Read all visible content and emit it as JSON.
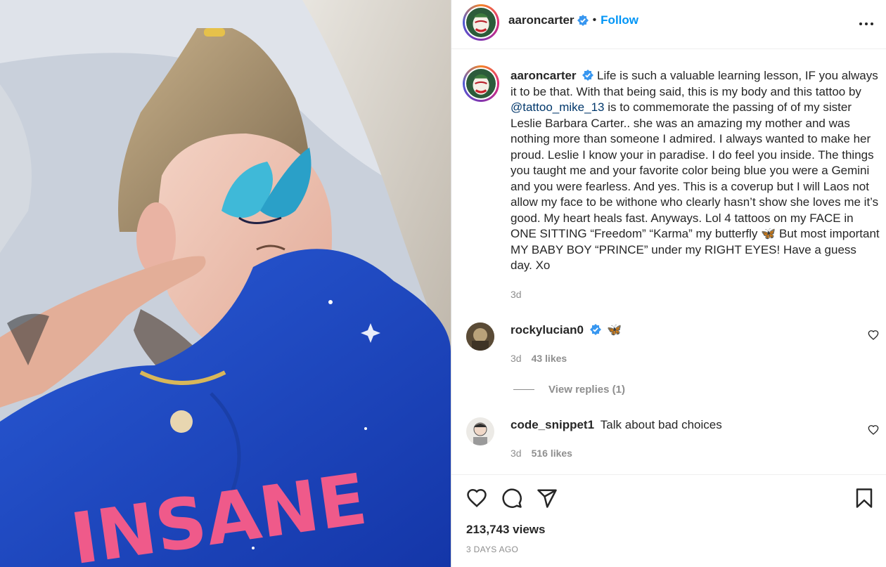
{
  "post": {
    "author": "aaroncarter",
    "follow_label": "Follow",
    "dot": "•",
    "image_label": "Post photo: man with butterfly face tattoo in blue hoodie",
    "caption_prefix": "Life is such a valuable learning lesson, IF you always it to be that. With that being said, this is my body and this tattoo by",
    "caption_mention": "@tattoo_mike_13",
    "caption_suffix": "is to commemorate the passing of of my sister Leslie Barbara Carter.. she was an amazing my mother and was nothing more than someone I admired. I always wanted to make her proud. Leslie I know your in paradise. I do feel you inside. The things you taught me and your favorite color being blue you were a Gemini and you were fearless. And yes. This is a coverup but I will Laos not allow my face to be withone who clearly hasn’t show she loves me it’s good. My heart heals fast. Anyways. Lol 4 tattoos on my FACE in ONE SITTING “Freedom” “Karma” my butterfly 🦋 But most important MY BABY BOY “PRINCE” under my RIGHT EYES! Have a guess day. Xo",
    "caption_time": "3d",
    "views": "213,743 views",
    "posted_ago": "3 DAYS AGO",
    "hoodie_text": "INSANE"
  },
  "comments": [
    {
      "user": "rockylucian0",
      "text": "🦋",
      "time": "3d",
      "likes": "43 likes",
      "view_replies": "View replies (1)"
    },
    {
      "user": "code_snippet1",
      "text": "Talk about bad choices",
      "time": "3d",
      "likes": "516 likes"
    }
  ],
  "colors": {
    "accent": "#0095f6",
    "text": "#262626",
    "muted": "#8e8e8e",
    "verified": "#3897f0",
    "hoodie": "#1f4fc9"
  },
  "icons": [
    "heart-icon",
    "comment-icon",
    "share-icon",
    "bookmark-icon",
    "more-icon",
    "verified-icon"
  ]
}
